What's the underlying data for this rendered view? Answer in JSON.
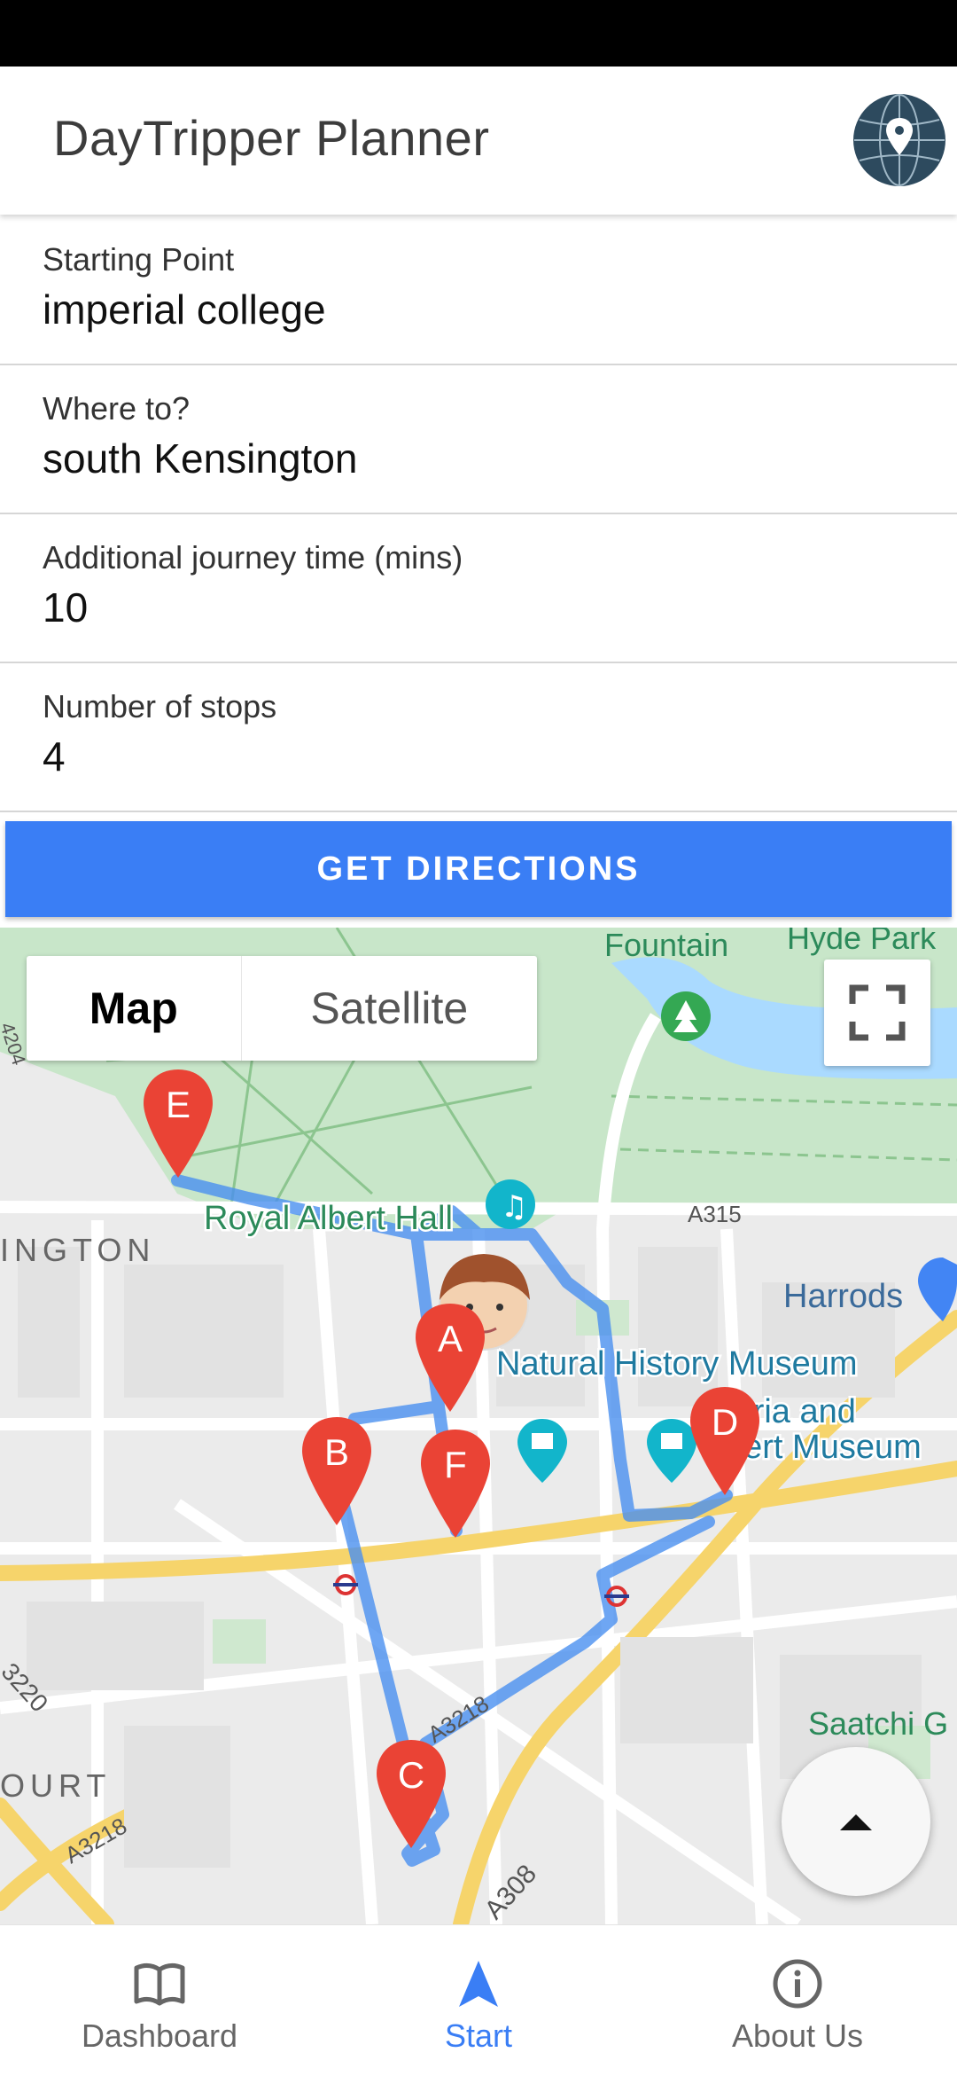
{
  "app": {
    "title": "DayTripper Planner"
  },
  "form": {
    "starting_point": {
      "label": "Starting Point",
      "value": "imperial college"
    },
    "destination": {
      "label": "Where to?",
      "value": "south Kensington"
    },
    "extra_time": {
      "label": "Additional journey time (mins)",
      "value": "10"
    },
    "stops": {
      "label": "Number of stops",
      "value": "4"
    },
    "submit_label": "GET DIRECTIONS"
  },
  "map": {
    "type_options": [
      "Map",
      "Satellite"
    ],
    "selected_type": "Map",
    "places": {
      "fountain": "Fountain",
      "hyde_park": "Hyde Park",
      "royal_albert_hall": "Royal Albert Hall",
      "a315": "A315",
      "harrods": "Harrods",
      "natural_history_museum": "Natural History Museum",
      "va_line1": "toria and",
      "va_line2": "bert Museum",
      "ington": "INGTON",
      "saatchi": "Saatchi G",
      "a3218_top": "A3218",
      "a3218_bottom": "A3218",
      "a3220": "3220",
      "ourt": "OURT",
      "a308": "A308",
      "a4204": "4204"
    },
    "markers": [
      "A",
      "B",
      "C",
      "D",
      "E",
      "F"
    ],
    "route_color": "#4a90f0",
    "marker_color": "#ea4335"
  },
  "nav": {
    "items": [
      {
        "label": "Dashboard",
        "icon": "book-icon"
      },
      {
        "label": "Start",
        "icon": "navigation-arrow-icon"
      },
      {
        "label": "About Us",
        "icon": "info-icon"
      }
    ],
    "active": "Start",
    "active_color": "#3a7ef5"
  }
}
